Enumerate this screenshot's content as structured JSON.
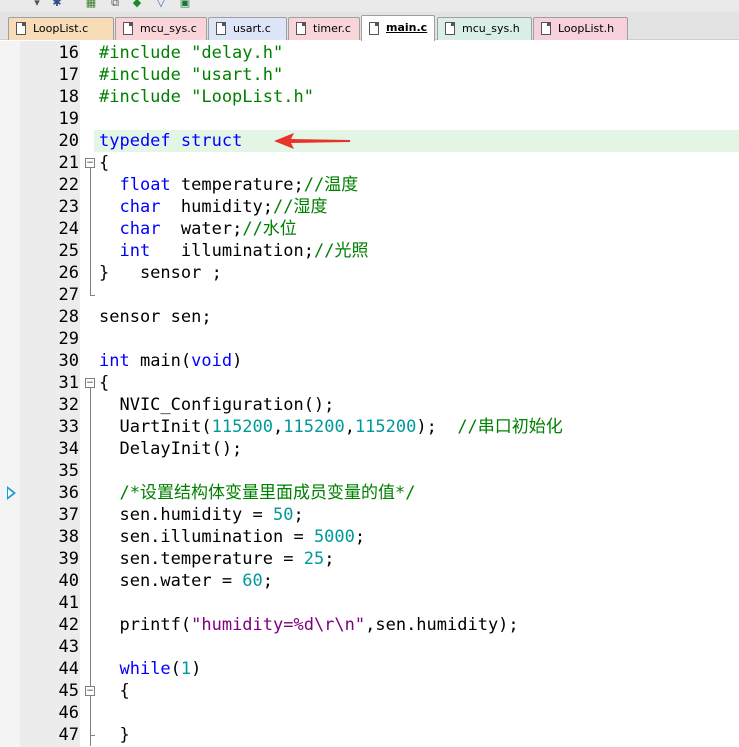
{
  "tabs": [
    {
      "label": "LoopList.c",
      "color": "#f8dcb7"
    },
    {
      "label": "mcu_sys.c",
      "color": "#f9d4d8"
    },
    {
      "label": "usart.c",
      "color": "#dde6f8"
    },
    {
      "label": "timer.c",
      "color": "#f7d5d9"
    },
    {
      "label": "main.c",
      "color": "#ffffff"
    },
    {
      "label": "mcu_sys.h",
      "color": "#d8eee6"
    },
    {
      "label": "LoopList.h",
      "color": "#f6d0da"
    }
  ],
  "active_tab": "main.c",
  "lines": [
    {
      "n": "16",
      "tokens": [
        {
          "t": "#include \"delay.h\"",
          "c": "pp"
        }
      ]
    },
    {
      "n": "17",
      "tokens": [
        {
          "t": "#include \"usart.h\"",
          "c": "pp"
        }
      ]
    },
    {
      "n": "18",
      "tokens": [
        {
          "t": "#include \"LoopList.h\"",
          "c": "pp"
        }
      ]
    },
    {
      "n": "19",
      "tokens": []
    },
    {
      "n": "20",
      "tokens": [
        {
          "t": "typedef",
          "c": "kw"
        },
        {
          "t": " "
        },
        {
          "t": "struct",
          "c": "kw"
        }
      ]
    },
    {
      "n": "21",
      "tokens": [
        {
          "t": "{"
        }
      ]
    },
    {
      "n": "22",
      "tokens": [
        {
          "t": "  "
        },
        {
          "t": "float",
          "c": "kw"
        },
        {
          "t": " temperature;"
        },
        {
          "t": "//温度",
          "c": "cm"
        }
      ]
    },
    {
      "n": "23",
      "tokens": [
        {
          "t": "  "
        },
        {
          "t": "char",
          "c": "kw"
        },
        {
          "t": "  humidity;"
        },
        {
          "t": "//湿度",
          "c": "cm"
        }
      ]
    },
    {
      "n": "24",
      "tokens": [
        {
          "t": "  "
        },
        {
          "t": "char",
          "c": "kw"
        },
        {
          "t": "  water;"
        },
        {
          "t": "//水位",
          "c": "cm"
        }
      ]
    },
    {
      "n": "25",
      "tokens": [
        {
          "t": "  "
        },
        {
          "t": "int",
          "c": "kw"
        },
        {
          "t": "   illumination;"
        },
        {
          "t": "//光照",
          "c": "cm"
        }
      ]
    },
    {
      "n": "26",
      "tokens": [
        {
          "t": "}   sensor ;"
        }
      ]
    },
    {
      "n": "27",
      "tokens": []
    },
    {
      "n": "28",
      "tokens": [
        {
          "t": "sensor sen;"
        }
      ]
    },
    {
      "n": "29",
      "tokens": []
    },
    {
      "n": "30",
      "tokens": [
        {
          "t": "int",
          "c": "kw"
        },
        {
          "t": " main("
        },
        {
          "t": "void",
          "c": "kw"
        },
        {
          "t": ")"
        }
      ]
    },
    {
      "n": "31",
      "tokens": [
        {
          "t": "{"
        }
      ]
    },
    {
      "n": "32",
      "tokens": [
        {
          "t": "  NVIC_Configuration();"
        }
      ]
    },
    {
      "n": "33",
      "tokens": [
        {
          "t": "  UartInit("
        },
        {
          "t": "115200",
          "c": "num"
        },
        {
          "t": ","
        },
        {
          "t": "115200",
          "c": "num"
        },
        {
          "t": ","
        },
        {
          "t": "115200",
          "c": "num"
        },
        {
          "t": ");  "
        },
        {
          "t": "//串口初始化",
          "c": "cm"
        }
      ]
    },
    {
      "n": "34",
      "tokens": [
        {
          "t": "  DelayInit();"
        }
      ]
    },
    {
      "n": "35",
      "tokens": []
    },
    {
      "n": "36",
      "tokens": [
        {
          "t": "  "
        },
        {
          "t": "/*设置结构体变量里面成员变量的值*/",
          "c": "cm"
        }
      ]
    },
    {
      "n": "37",
      "tokens": [
        {
          "t": "  sen.humidity = "
        },
        {
          "t": "50",
          "c": "num"
        },
        {
          "t": ";"
        }
      ]
    },
    {
      "n": "38",
      "tokens": [
        {
          "t": "  sen.illumination = "
        },
        {
          "t": "5000",
          "c": "num"
        },
        {
          "t": ";"
        }
      ]
    },
    {
      "n": "39",
      "tokens": [
        {
          "t": "  sen.temperature = "
        },
        {
          "t": "25",
          "c": "num"
        },
        {
          "t": ";"
        }
      ]
    },
    {
      "n": "40",
      "tokens": [
        {
          "t": "  sen.water = "
        },
        {
          "t": "60",
          "c": "num"
        },
        {
          "t": ";"
        }
      ]
    },
    {
      "n": "41",
      "tokens": []
    },
    {
      "n": "42",
      "tokens": [
        {
          "t": "  printf("
        },
        {
          "t": "\"humidity=%d\\r\\n\"",
          "c": "str"
        },
        {
          "t": ",sen.humidity);"
        }
      ]
    },
    {
      "n": "43",
      "tokens": []
    },
    {
      "n": "44",
      "tokens": [
        {
          "t": "  "
        },
        {
          "t": "while",
          "c": "kw"
        },
        {
          "t": "("
        },
        {
          "t": "1",
          "c": "num"
        },
        {
          "t": ")"
        }
      ]
    },
    {
      "n": "45",
      "tokens": [
        {
          "t": "  {"
        }
      ]
    },
    {
      "n": "46",
      "tokens": []
    },
    {
      "n": "47",
      "tokens": [
        {
          "t": "  }"
        }
      ]
    }
  ],
  "highlighted_line": "20",
  "bookmark_line": "36",
  "arrow_color": "#e8332a",
  "highlight_color": "#e3f6e6"
}
